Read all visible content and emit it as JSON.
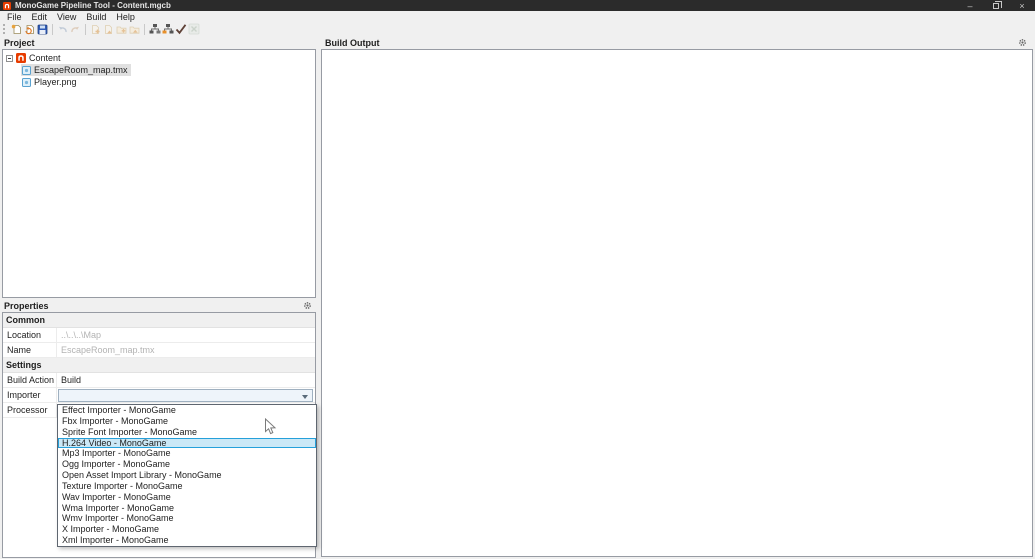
{
  "window": {
    "title": "MonoGame Pipeline Tool - Content.mgcb",
    "minimize_glyph": "–",
    "close_glyph": "×"
  },
  "menu": {
    "items": [
      "File",
      "Edit",
      "View",
      "Build",
      "Help"
    ]
  },
  "toolbar": {
    "icons": [
      "new-project-icon",
      "import-project-icon",
      "save-icon",
      "undo-icon",
      "redo-icon",
      "add-new-item-icon",
      "add-existing-item-icon",
      "add-new-folder-icon",
      "add-existing-folder-icon",
      "build-icon",
      "rebuild-icon",
      "clean-icon",
      "cancel-build-icon"
    ]
  },
  "project": {
    "header": "Project",
    "root_label": "Content",
    "files": [
      "EscapeRoom_map.tmx",
      "Player.png"
    ],
    "selected_file": "EscapeRoom_map.tmx"
  },
  "build_output": {
    "header": "Build Output"
  },
  "properties": {
    "header": "Properties",
    "common_title": "Common",
    "location_label": "Location",
    "location_value": "..\\..\\..\\Map",
    "name_label": "Name",
    "name_value": "EscapeRoom_map.tmx",
    "settings_title": "Settings",
    "build_action_label": "Build Action",
    "build_action_value": "Build",
    "importer_label": "Importer",
    "processor_label": "Processor"
  },
  "dropdown": {
    "items": [
      "Effect Importer - MonoGame",
      "Fbx Importer - MonoGame",
      "Sprite Font Importer - MonoGame",
      "H.264 Video - MonoGame",
      "Mp3 Importer - MonoGame",
      "Ogg Importer - MonoGame",
      "Open Asset Import Library - MonoGame",
      "Texture Importer - MonoGame",
      "Wav Importer - MonoGame",
      "Wma Importer - MonoGame",
      "Wmv Importer - MonoGame",
      "X Importer - MonoGame",
      "Xml Importer - MonoGame"
    ],
    "selected": "H.264 Video - MonoGame",
    "selected_index": 3,
    "highlight_color": "#cbe8f6",
    "highlight_border": "#26a0da"
  },
  "colors": {
    "titlebar_bg": "#2b2b2b",
    "accent_orange": "#e73c00",
    "chrome_bg": "#f0f0f0",
    "panel_border": "#979ba3",
    "save_blue": "#2f5bb7"
  }
}
